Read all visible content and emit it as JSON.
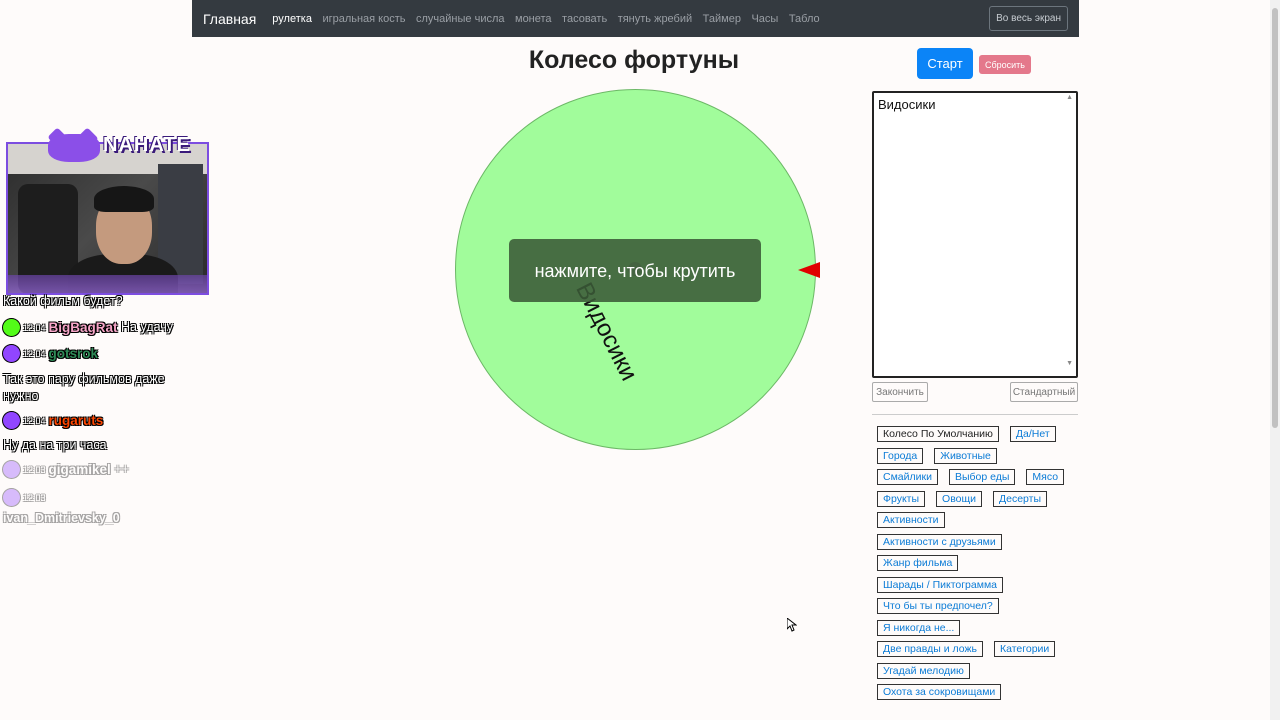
{
  "navbar": {
    "brand": "Главная",
    "links": [
      "рулетка",
      "игральная кость",
      "случайные числа",
      "монета",
      "тасовать",
      "тянуть жребий",
      "Таймер",
      "Часы",
      "Табло"
    ],
    "fullscreen": "Во весь экран"
  },
  "title": "Колесо фортуны",
  "buttons": {
    "start": "Старт",
    "reset": "Сбросить",
    "finish": "Закончить",
    "standard": "Стандартный"
  },
  "wheel": {
    "segment_label": "Видосики",
    "overlay_text": "нажмите, чтобы крутить",
    "color": "#a1fc9b",
    "pointer_color": "#e00000"
  },
  "entries_text": "Видосики",
  "presets": [
    [
      "Колесо По Умолчанию",
      "Да/Нет"
    ],
    [
      "Города",
      "Животные"
    ],
    [
      "Смайлики",
      "Выбор еды",
      "Мясо"
    ],
    [
      "Фрукты",
      "Овощи",
      "Десерты"
    ],
    [
      "Активности"
    ],
    [
      "Активности с друзьями"
    ],
    [
      "Жанр фильма"
    ],
    [
      "Шарады / Пиктограмма"
    ],
    [
      "Что бы ты предпочел?"
    ],
    [
      "Я никогда не..."
    ],
    [
      "Две правды и ложь",
      "Категории"
    ],
    [
      "Угадай мелодию"
    ],
    [
      "Охота за сокровищами"
    ]
  ],
  "stream": {
    "brand": "NAHATE",
    "chat": [
      {
        "text": "Какой фильм будет?"
      },
      {
        "platform": "kick",
        "time": "12:04",
        "nick": "BigBagRat",
        "nick_color": "#f7a6c8",
        "text": "На удачу"
      },
      {
        "platform": "twitch",
        "time": "12:04",
        "nick": "gotsrok",
        "nick_color": "#2e8b57",
        "text": ""
      },
      {
        "text": "Так это пару фильмов даже"
      },
      {
        "text": "нужно"
      },
      {
        "platform": "twitch",
        "time": "12:04",
        "nick": "rugaruts",
        "nick_color": "#ff4500",
        "text": ""
      },
      {
        "text": "Ну да на три часа"
      },
      {
        "platform": "twitch",
        "time": "12:03",
        "nick": "gigamikel",
        "nick_color": "#ffffff",
        "text": "++"
      },
      {
        "platform": "twitch",
        "time": "12:03",
        "nick": "",
        "nick_color": "#ffffff",
        "text": ""
      },
      {
        "text": "ivan_Dmitrievsky_0"
      }
    ]
  }
}
